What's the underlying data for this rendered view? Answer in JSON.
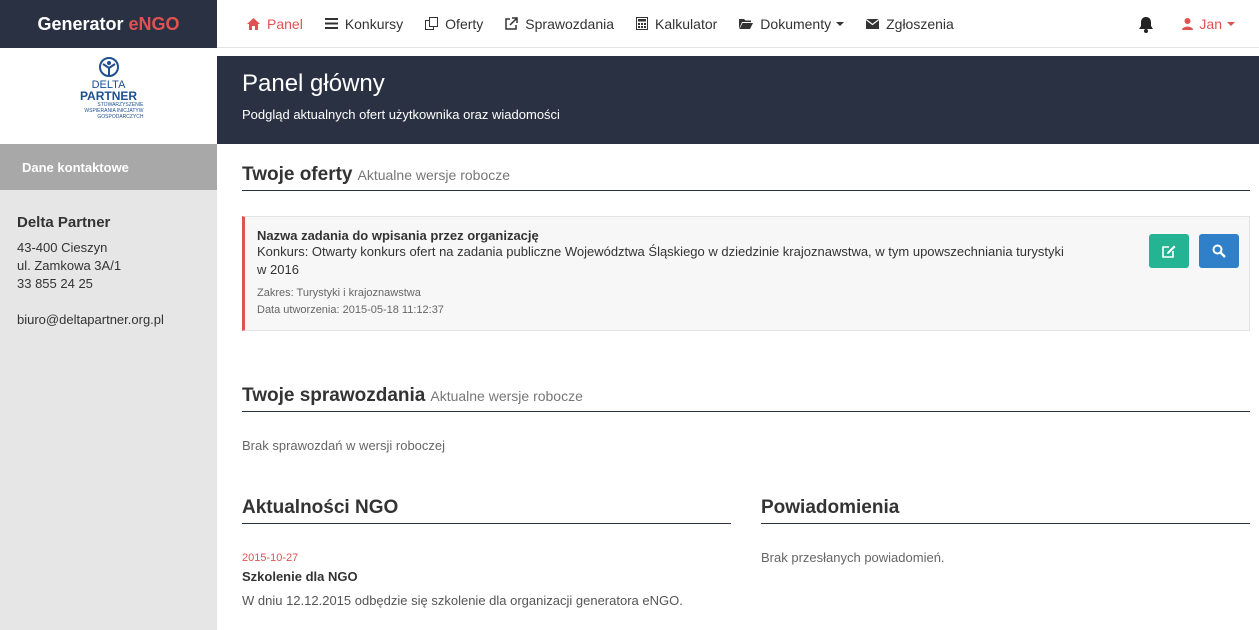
{
  "brand": {
    "name": "Generator",
    "accent": "eNGO"
  },
  "nav": {
    "items": [
      {
        "label": "Panel",
        "icon": "home-icon"
      },
      {
        "label": "Konkursy",
        "icon": "list-icon"
      },
      {
        "label": "Oferty",
        "icon": "copy-icon"
      },
      {
        "label": "Sprawozdania",
        "icon": "external-link-icon"
      },
      {
        "label": "Kalkulator",
        "icon": "calculator-icon"
      },
      {
        "label": "Dokumenty",
        "icon": "folder-icon"
      },
      {
        "label": "Zgłoszenia",
        "icon": "envelope-icon"
      }
    ],
    "user": "Jan"
  },
  "sidebar": {
    "logo": {
      "line1": "DELTA",
      "line2": "PARTNER",
      "line3": "STOWARZYSZENIE WSPIERANIA INICJATYW GOSPODARCZYCH"
    },
    "header": "Dane kontaktowe",
    "org": "Delta Partner",
    "address1": "43-400 Cieszyn",
    "address2": "ul. Zamkowa 3A/1",
    "phone": "33 855 24 25",
    "email": "biuro@deltapartner.org.pl"
  },
  "hero": {
    "title": "Panel główny",
    "subtitle": "Podgląd aktualnych ofert użytkownika oraz wiadomości"
  },
  "offers": {
    "title": "Twoje oferty",
    "subtitle": "Aktualne wersje robocze",
    "item": {
      "name": "Nazwa zadania do wpisania przez organizację",
      "konkurs": "Konkurs: Otwarty konkurs ofert na zadania publiczne Województwa Śląskiego w dziedzinie krajoznawstwa, w tym upowszechniania turystyki w 2016",
      "zakres": "Zakres: Turystyki i krajoznawstwa",
      "created": "Data utworzenia: 2015-05-18 11:12:37"
    }
  },
  "reports": {
    "title": "Twoje sprawozdania",
    "subtitle": "Aktualne wersje robocze",
    "empty": "Brak sprawozdań w wersji roboczej"
  },
  "news": {
    "title": "Aktualności NGO",
    "date": "2015-10-27",
    "headline": "Szkolenie dla NGO",
    "body": "W dniu 12.12.2015 odbędzie się szkolenie dla organizacji generatora eNGO."
  },
  "notifications": {
    "title": "Powiadomienia",
    "empty": "Brak przesłanych powiadomień."
  },
  "colors": {
    "dark": "#2a3142",
    "accent": "#e05252",
    "green": "#25b493",
    "blue": "#2f80c9"
  }
}
